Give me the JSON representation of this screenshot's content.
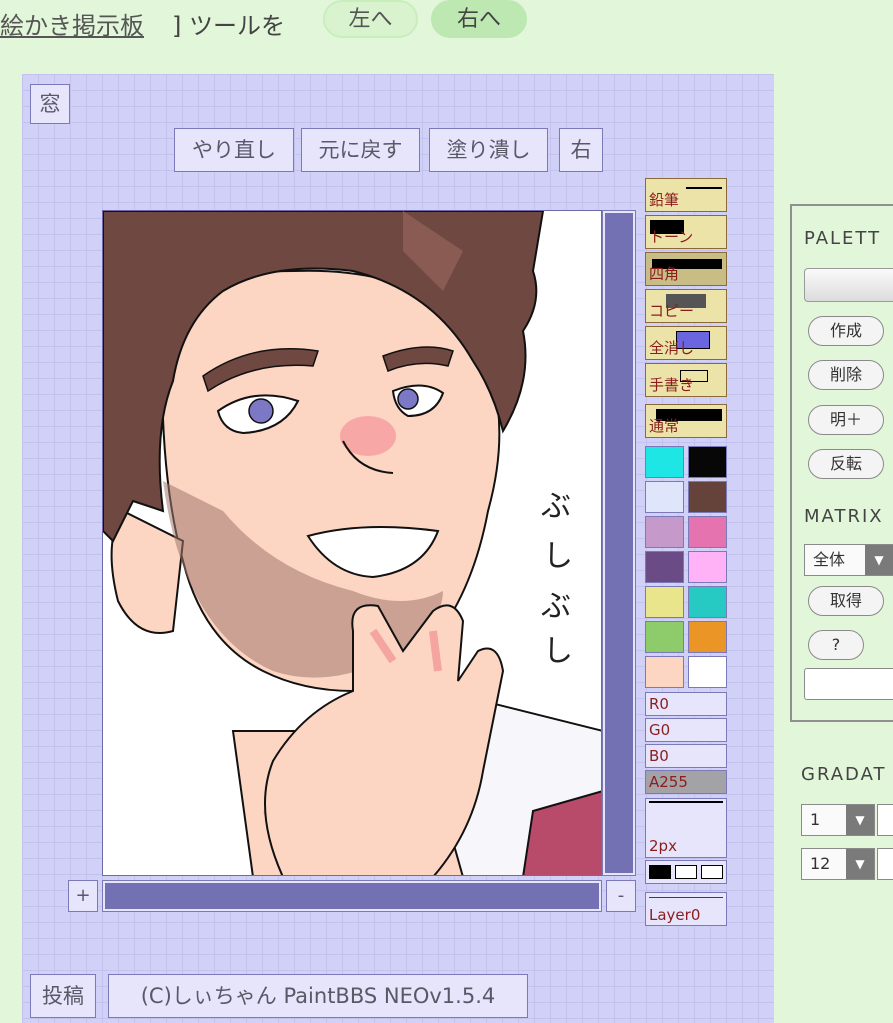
{
  "header": {
    "board_link": "絵かき掲示板",
    "suffix": "] ツールを",
    "left_button": "左へ",
    "right_button": "右へ"
  },
  "neo": {
    "window_button": "窓",
    "redo_button": "やり直し",
    "undo_button": "元に戻す",
    "fill_button": "塗り潰し",
    "side_button": "右",
    "zoom_in": "+",
    "zoom_out": "-",
    "submit_button": "投稿",
    "copyright": "(C)しぃちゃん PaintBBS NEOv1.5.4"
  },
  "tools": [
    {
      "label": "鉛筆",
      "icon": "pencil-icon"
    },
    {
      "label": "トーン",
      "icon": "tone-icon"
    },
    {
      "label": "四角",
      "icon": "rectangle-icon"
    },
    {
      "label": "コピー",
      "icon": "copy-icon"
    },
    {
      "label": "全消し",
      "icon": "clear-icon"
    },
    {
      "label": "手書き",
      "icon": "freehand-icon"
    },
    {
      "label": "通常",
      "icon": "normal-icon"
    }
  ],
  "palette_colors": [
    "#1de6e4",
    "#070707",
    "#dfe6fb",
    "#66433a",
    "#c599c9",
    "#e473b0",
    "#6a4b86",
    "#ffb2f6",
    "#e9e58c",
    "#27c9c3",
    "#8ecb6b",
    "#ea9526",
    "#fcd6c3",
    "#ffffff"
  ],
  "sliders": {
    "r": "R0",
    "g": "G0",
    "b": "B0",
    "a": "A255"
  },
  "brush_size": "2px",
  "layer": "Layer0",
  "palette_panel": {
    "title": "PALETT",
    "buttons": [
      "作成",
      "削除",
      "明＋",
      "反転"
    ],
    "matrix_title": "MATRIX",
    "matrix_select": "全体",
    "get_button": "取得",
    "help_button": "?"
  },
  "gradation": {
    "title": "GRADAT",
    "select_1": "1",
    "select_2": "12"
  },
  "drawing": {
    "text_lines": [
      "ぶ",
      "し",
      "ぶ",
      "し"
    ],
    "colors": {
      "skin": "#fcd6c3",
      "hair": "#6e4841",
      "accent": "#d3567b"
    }
  }
}
